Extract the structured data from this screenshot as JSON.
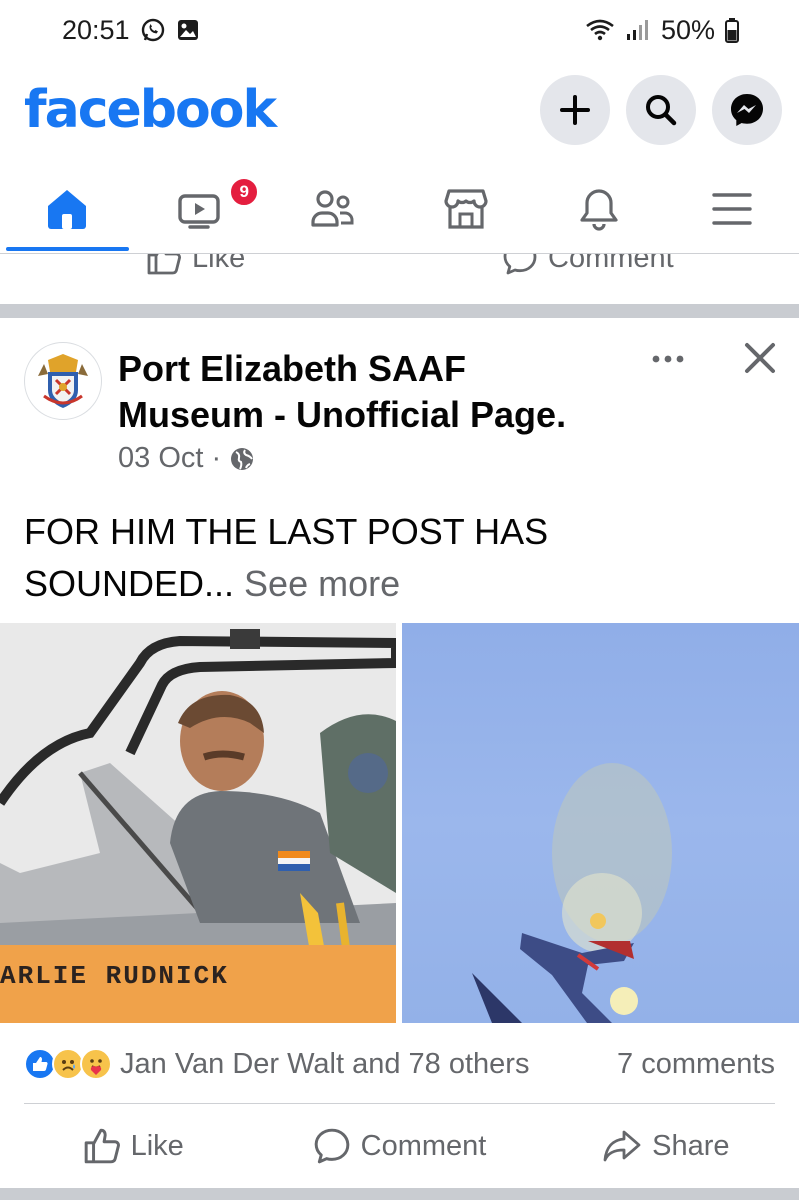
{
  "status_bar": {
    "time": "20:51",
    "battery": "50%",
    "left_icons": [
      "whatsapp-icon",
      "gallery-icon"
    ],
    "right_icons": [
      "wifi-icon",
      "signal-icon",
      "battery-icon"
    ]
  },
  "header": {
    "logo": "facebook",
    "brand_color": "#1877f2",
    "actions": [
      "plus-icon",
      "search-icon",
      "messenger-icon"
    ]
  },
  "nav": {
    "tabs": [
      {
        "icon": "home-icon",
        "active": true
      },
      {
        "icon": "video-icon",
        "badge": "9"
      },
      {
        "icon": "friends-icon"
      },
      {
        "icon": "marketplace-icon"
      },
      {
        "icon": "bell-icon"
      },
      {
        "icon": "menu-icon"
      }
    ]
  },
  "previous_post": {
    "like_label": "Like",
    "comment_label": "Comment"
  },
  "post": {
    "page_name": "Port Elizabeth SAAF Museum - Unofficial Page.",
    "date": "03 Oct",
    "separator": "·",
    "text": "FOR HIM THE LAST POST HAS SOUNDED...",
    "see_more": "See more",
    "photo_caption": "ARLIE RUDNICK",
    "reactions": {
      "icons": [
        "like-reaction-icon",
        "sad-reaction-icon",
        "care-reaction-icon"
      ],
      "names": "Jan Van Der Walt and 78 others",
      "comments": "7 comments"
    },
    "actions": {
      "like": "Like",
      "comment": "Comment",
      "share": "Share"
    }
  }
}
